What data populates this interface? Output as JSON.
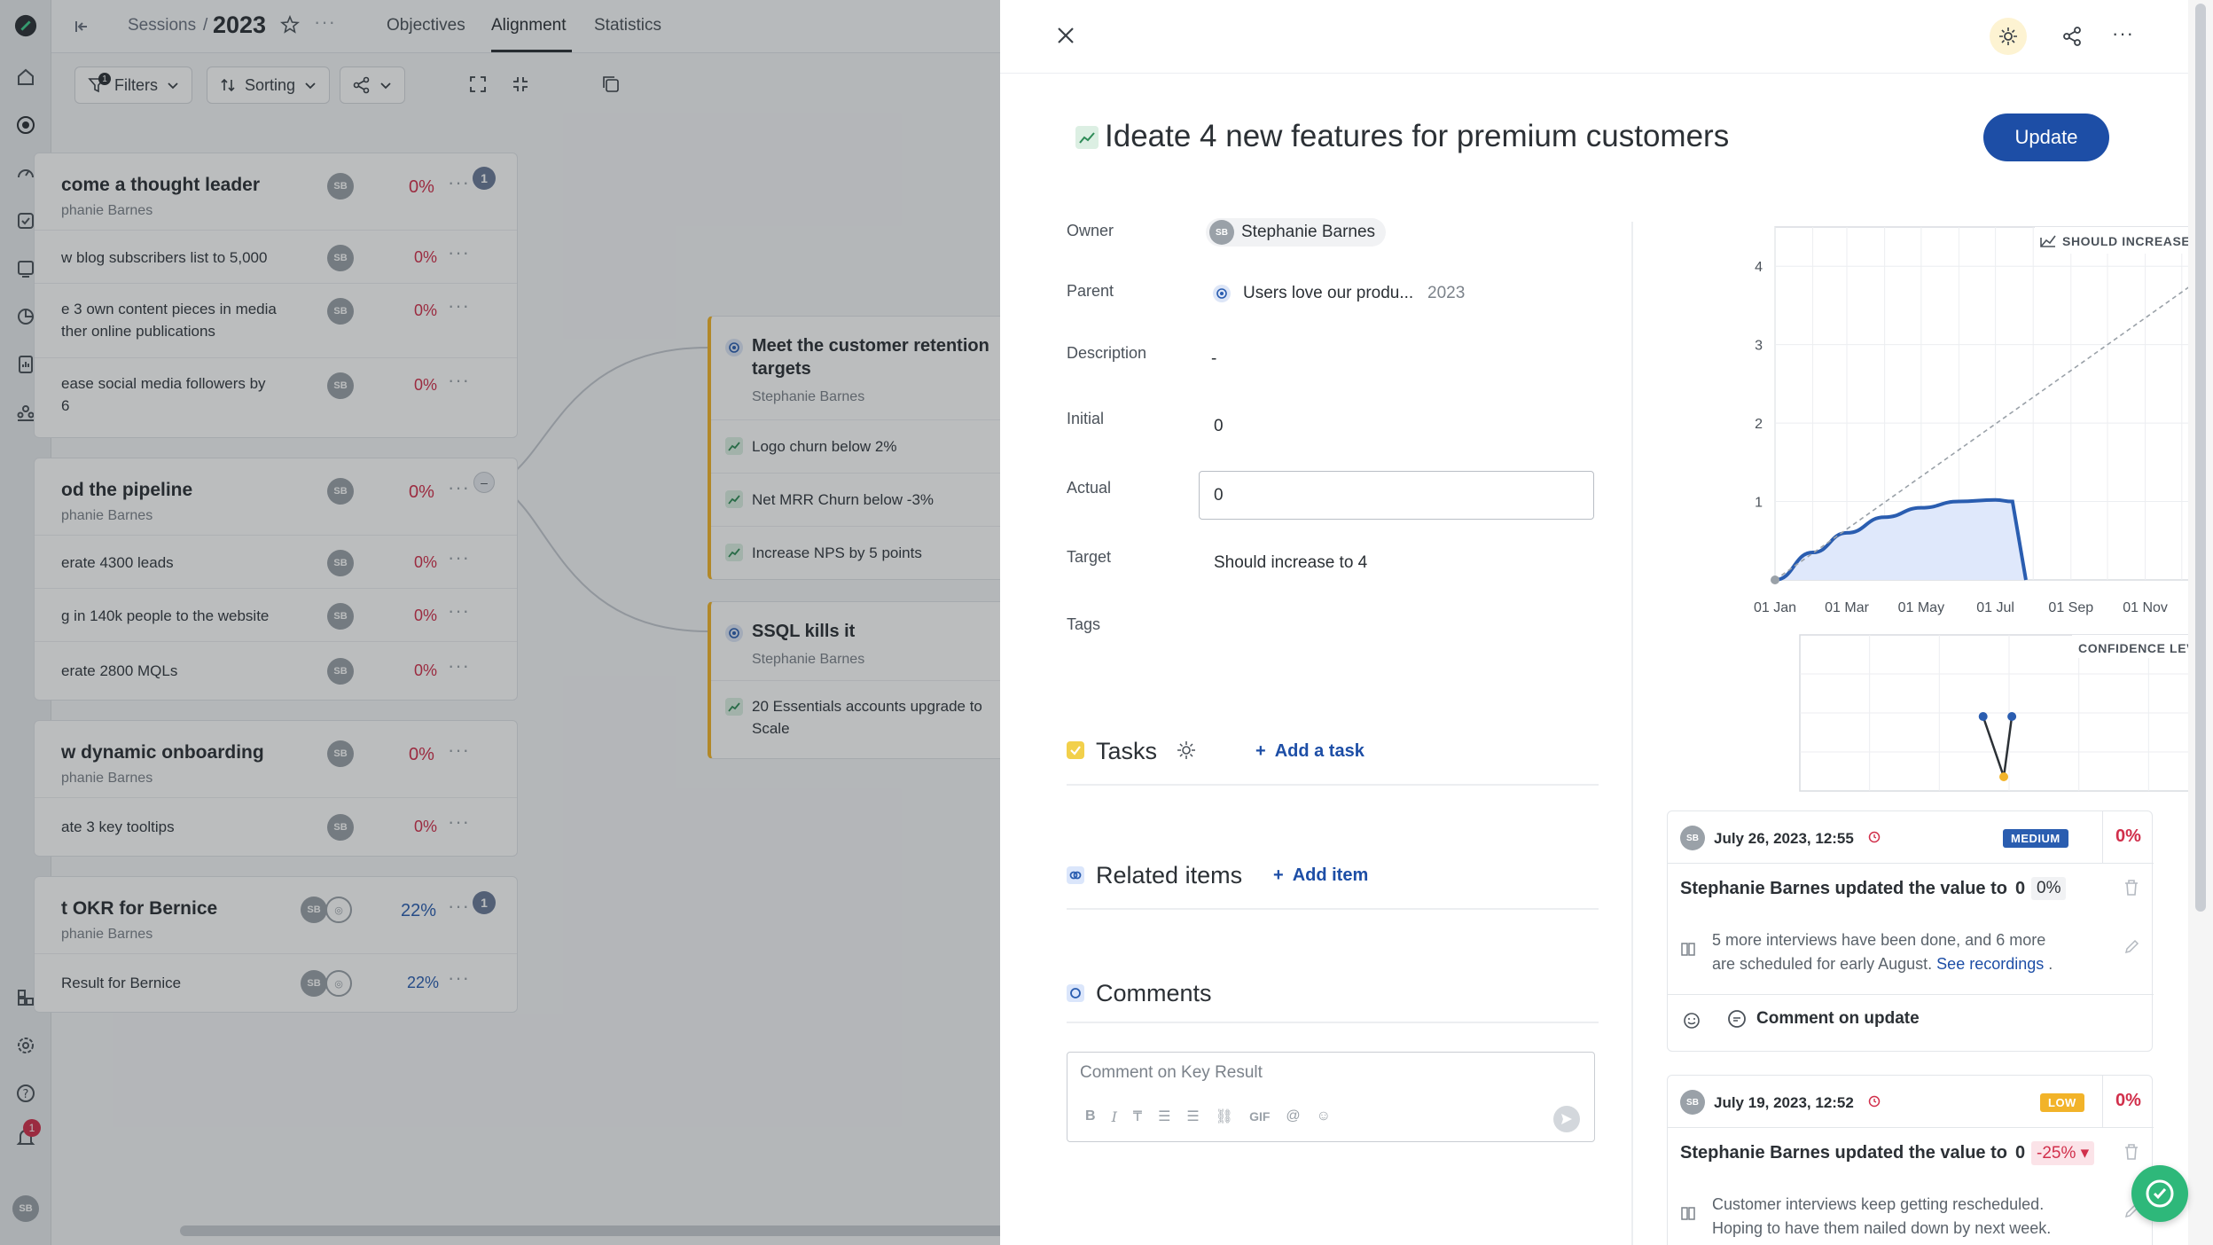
{
  "breadcrumb": {
    "section": "Sessions",
    "sep": "/",
    "year": "2023"
  },
  "tabs": [
    {
      "label": "Objectives"
    },
    {
      "label": "Alignment"
    },
    {
      "label": "Statistics"
    }
  ],
  "toolbar": {
    "filters_label": "Filters",
    "filters_count": "1",
    "sorting_label": "Sorting"
  },
  "rail": {
    "notification_count": "1",
    "user_initials": "SB"
  },
  "objectives": [
    {
      "title": "come a thought leader",
      "owner": "phanie Barnes",
      "pct": "0%",
      "badge": "1",
      "krs": [
        {
          "text": "w blog subscribers list to 5,000",
          "pct": "0%"
        },
        {
          "text": "e 3 own content pieces in media",
          "text2": "ther online publications",
          "pct": "0%"
        },
        {
          "text": "ease social media followers by",
          "text2": "6",
          "pct": "0%"
        }
      ]
    },
    {
      "title": "od the pipeline",
      "owner": "phanie Barnes",
      "pct": "0%",
      "connector": "–",
      "krs": [
        {
          "text": "erate 4300 leads",
          "pct": "0%"
        },
        {
          "text": "g in 140k people to the website",
          "pct": "0%"
        },
        {
          "text": "erate 2800 MQLs",
          "pct": "0%"
        }
      ]
    },
    {
      "title": "w dynamic onboarding",
      "owner": "phanie Barnes",
      "pct": "0%",
      "krs": [
        {
          "text": "ate 3 key tooltips",
          "pct": "0%"
        }
      ]
    },
    {
      "title": "t OKR for Bernice",
      "owner": "phanie Barnes",
      "pct": "22%",
      "badge": "1",
      "krs": [
        {
          "text": " Result for Bernice",
          "pct": "22%"
        }
      ]
    }
  ],
  "children": [
    {
      "title": "Meet the customer retention",
      "title2": "targets",
      "owner": "Stephanie Barnes",
      "krs": [
        "Logo churn below 2%",
        "Net MRR Churn below -3%",
        "Increase NPS by 5 points"
      ]
    },
    {
      "title": "SSQL kills it",
      "owner": "Stephanie Barnes",
      "krs": [
        "20 Essentials accounts upgrade to",
        "Scale"
      ]
    }
  ],
  "panel": {
    "title": "Ideate 4 new features for premium customers",
    "update_label": "Update",
    "owner_label": "Owner",
    "owner_name": "Stephanie Barnes",
    "owner_initials": "SB",
    "parent_label": "Parent",
    "parent_name": "Users love our produ...",
    "parent_year": "2023",
    "description_label": "Description",
    "description": "-",
    "initial_label": "Initial",
    "initial": "0",
    "actual_label": "Actual",
    "actual": "0",
    "target_label": "Target",
    "target": "Should increase to 4",
    "tags_label": "Tags",
    "tasks_label": "Tasks",
    "add_task": "Add a task",
    "related_label": "Related items",
    "add_item": "Add item",
    "comments_label": "Comments",
    "comment_placeholder": "Comment on Key Result",
    "editor_gif": "GIF"
  },
  "chart_data": [
    {
      "type": "area",
      "title": "",
      "legend": "SHOULD INCREASE TO",
      "xlabel": "",
      "ylabel": "",
      "x_ticks": [
        "01 Jan",
        "01 Mar",
        "01 May",
        "01 Jul",
        "01 Sep",
        "01 Nov"
      ],
      "y_ticks": [
        1,
        2,
        3,
        4
      ],
      "ylim": [
        0,
        4.5
      ],
      "grid": true,
      "series": [
        {
          "name": "",
          "values": [
            {
              "x": "01 Jan",
              "y": 0
            },
            {
              "x": "01 Feb",
              "y": 0.35
            },
            {
              "x": "01 Mar",
              "y": 0.6
            },
            {
              "x": "01 Apr",
              "y": 0.8
            },
            {
              "x": "01 May",
              "y": 0.92
            },
            {
              "x": "01 Jun",
              "y": 1.0
            },
            {
              "x": "01 Jul",
              "y": 1.02
            },
            {
              "x": "15 Jul",
              "y": 1.0
            },
            {
              "x": "26 Jul",
              "y": 0
            }
          ]
        },
        {
          "name": "SHOULD INCREASE TO",
          "values": [
            {
              "x": "01 Jan",
              "y": 0
            },
            {
              "x": "31 Dec",
              "y": 4
            }
          ]
        }
      ]
    },
    {
      "type": "scatter",
      "legend": "CONFIDENCE LEVEL",
      "grid": true,
      "series": [
        {
          "name": "",
          "values": [
            {
              "x": "01 Jul",
              "y": "MEDIUM"
            },
            {
              "x": "19 Jul",
              "y": "LOW"
            },
            {
              "x": "26 Jul",
              "y": "MEDIUM"
            }
          ]
        }
      ]
    }
  ],
  "updates": [
    {
      "initials": "SB",
      "date": "July 26, 2023, 12:55",
      "level": "MEDIUM",
      "level_color": "#2a5db0",
      "pct": "0%",
      "text": "Stephanie Barnes updated the value to",
      "value": "0",
      "delta": "0%",
      "note1": "5 more interviews have been done, and 6 more",
      "note2": "are scheduled for early August.",
      "link": "See recordings",
      "period": " .",
      "comment_label": "Comment on update"
    },
    {
      "initials": "SB",
      "date": "July 19, 2023, 12:52",
      "level": "LOW",
      "level_color": "#f2b329",
      "pct": "0%",
      "text": "Stephanie Barnes updated the value to",
      "value": "0",
      "delta": "-25%",
      "note1": "Customer interviews keep getting rescheduled.",
      "note2": "Hoping to have them nailed down by next week."
    }
  ],
  "colors": {
    "primary": "#1d4ea6",
    "negative": "#d12f4b",
    "series": "#2a5db0"
  }
}
